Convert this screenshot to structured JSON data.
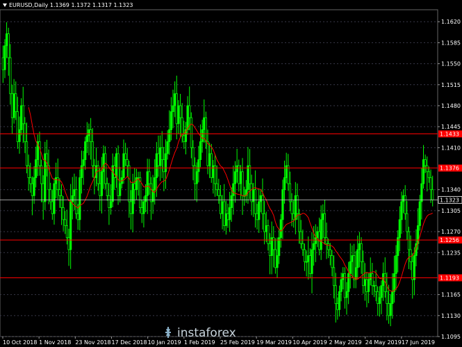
{
  "header": {
    "symbol_tf": "EURUSD,Daily",
    "ohlc": "1.1369 1.1372 1.1317 1.1323"
  },
  "watermark": {
    "text": "instaforex"
  },
  "colors": {
    "background": "#000000",
    "candle": "#00ff00",
    "moving_average": "#ff0000",
    "level_line": "#ff0000",
    "level_label_bg": "#ff0000",
    "axis_text": "#ffffff",
    "grid": "#3a3a4a"
  },
  "chart_data": {
    "type": "candlestick",
    "symbol": "EURUSD",
    "timeframe": "Daily",
    "ylim": [
      1.1095,
      1.164
    ],
    "y_ticks": [
      "1.1620",
      "1.1585",
      "1.1550",
      "1.1515",
      "1.1480",
      "1.1445",
      "1.1410",
      "1.1340",
      "1.1305",
      "1.1270",
      "1.1235",
      "1.1165",
      "1.1130",
      "1.1095"
    ],
    "x_ticks": [
      "10 Oct 2018",
      "1 Nov 2018",
      "23 Nov 2018",
      "17 Dec 2018",
      "10 Jan 2019",
      "1 Feb 2019",
      "25 Feb 2019",
      "19 Mar 2019",
      "10 Apr 2019",
      "2 May 2019",
      "24 May 2019",
      "17 Jun 2019"
    ],
    "current_price": "1.1323",
    "levels": [
      {
        "value": 1.1433,
        "label": "1.1433"
      },
      {
        "value": 1.1376,
        "label": "1.1376"
      },
      {
        "value": 1.1256,
        "label": "1.1256"
      },
      {
        "value": 1.1193,
        "label": "1.1193"
      }
    ],
    "closes": [
      1.154,
      1.158,
      1.16,
      1.156,
      1.15,
      1.146,
      1.15,
      1.147,
      1.142,
      1.144,
      1.148,
      1.145,
      1.142,
      1.138,
      1.136,
      1.135,
      1.133,
      1.136,
      1.139,
      1.142,
      1.138,
      1.135,
      1.132,
      1.14,
      1.138,
      1.134,
      1.132,
      1.13,
      1.135,
      1.136,
      1.134,
      1.133,
      1.131,
      1.129,
      1.128,
      1.126,
      1.124,
      1.132,
      1.133,
      1.134,
      1.13,
      1.129,
      1.136,
      1.138,
      1.139,
      1.142,
      1.143,
      1.144,
      1.142,
      1.138,
      1.136,
      1.138,
      1.135,
      1.133,
      1.137,
      1.14,
      1.135,
      1.133,
      1.131,
      1.132,
      1.138,
      1.136,
      1.14,
      1.133,
      1.135,
      1.136,
      1.14,
      1.139,
      1.138,
      1.132,
      1.13,
      1.135,
      1.134,
      1.136,
      1.136,
      1.131,
      1.13,
      1.132,
      1.133,
      1.137,
      1.135,
      1.132,
      1.134,
      1.136,
      1.14,
      1.138,
      1.141,
      1.139,
      1.137,
      1.14,
      1.142,
      1.144,
      1.147,
      1.148,
      1.15,
      1.145,
      1.148,
      1.146,
      1.143,
      1.142,
      1.144,
      1.148,
      1.146,
      1.141,
      1.138,
      1.135,
      1.137,
      1.139,
      1.142,
      1.144,
      1.146,
      1.142,
      1.138,
      1.14,
      1.136,
      1.138,
      1.135,
      1.134,
      1.133,
      1.13,
      1.132,
      1.128,
      1.13,
      1.129,
      1.131,
      1.133,
      1.135,
      1.137,
      1.138,
      1.135,
      1.137,
      1.133,
      1.133,
      1.134,
      1.138,
      1.135,
      1.132,
      1.134,
      1.13,
      1.129,
      1.132,
      1.133,
      1.13,
      1.127,
      1.128,
      1.125,
      1.123,
      1.126,
      1.124,
      1.121,
      1.123,
      1.126,
      1.129,
      1.134,
      1.136,
      1.138,
      1.135,
      1.132,
      1.13,
      1.129,
      1.133,
      1.13,
      1.127,
      1.125,
      1.124,
      1.122,
      1.122,
      1.123,
      1.12,
      1.124,
      1.125,
      1.126,
      1.127,
      1.124,
      1.129,
      1.13,
      1.126,
      1.125,
      1.124,
      1.123,
      1.121,
      1.118,
      1.115,
      1.114,
      1.117,
      1.119,
      1.12,
      1.116,
      1.117,
      1.12,
      1.122,
      1.123,
      1.119,
      1.121,
      1.124,
      1.125,
      1.122,
      1.118,
      1.119,
      1.117,
      1.119,
      1.12,
      1.118,
      1.118,
      1.117,
      1.115,
      1.116,
      1.118,
      1.12,
      1.117,
      1.115,
      1.113,
      1.115,
      1.117,
      1.12,
      1.123,
      1.126,
      1.129,
      1.132,
      1.133,
      1.13,
      1.127,
      1.124,
      1.122,
      1.119,
      1.123,
      1.125,
      1.128,
      1.132,
      1.135,
      1.139,
      1.138,
      1.137,
      1.136,
      1.134,
      1.1323
    ],
    "ma_period": 15
  }
}
